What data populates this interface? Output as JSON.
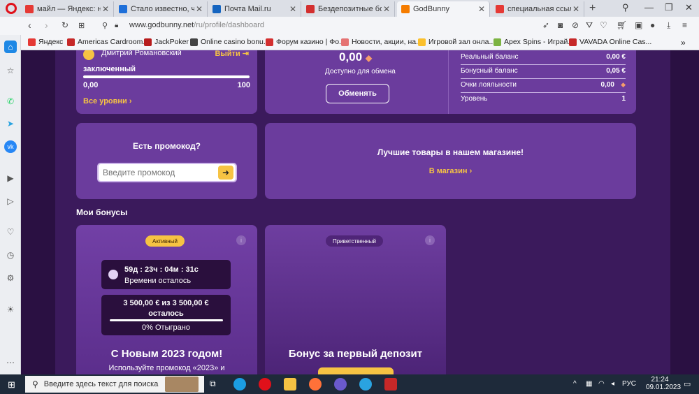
{
  "tabs": [
    {
      "title": "майл — Яндекс: нашло",
      "color": "#e53935",
      "active": false
    },
    {
      "title": "Стало известно, что пр",
      "color": "#1e6fd9",
      "active": false
    },
    {
      "title": "Почта Mail.ru",
      "color": "#1565c0",
      "active": false
    },
    {
      "title": "Бездепозитные бонус",
      "color": "#d32f2f",
      "active": false
    },
    {
      "title": "GodBunny",
      "color": "#f57c00",
      "active": true
    },
    {
      "title": "специальная ссылка на",
      "color": "#e53935",
      "active": false
    }
  ],
  "address": {
    "url_host": "www.godbunny.net",
    "url_path": "/ru/profile/dashboard"
  },
  "bookmarks": [
    {
      "label": "Яндекс",
      "color": "#e53935"
    },
    {
      "label": "Americas Cardroom...",
      "color": "#c62828"
    },
    {
      "label": "JackPoker",
      "color": "#b71c1c"
    },
    {
      "label": "Online casino bonu...",
      "color": "#444444"
    },
    {
      "label": "Форум казино | Фо...",
      "color": "#d32f2f"
    },
    {
      "label": "Новости, акции, на...",
      "color": "#e57373"
    },
    {
      "label": "Игровой зал онла...",
      "color": "#fbc02d"
    },
    {
      "label": "Apex Spins - Играй...",
      "color": "#7cb342"
    },
    {
      "label": "VAVADA Online Cas...",
      "color": "#c62828"
    }
  ],
  "level_card": {
    "user_name": "Дмитрий Романовский",
    "logout": "Выйти",
    "level_name": "заключенный",
    "progress_min": "0,00",
    "progress_max": "100",
    "progress_fraction": 0.0,
    "all_levels": "Все уровни"
  },
  "exchange_card": {
    "amount": "0,00",
    "available_label": "Доступно для обмена",
    "exchange_button": "Обменять"
  },
  "balances": [
    {
      "label": "Реальный баланс",
      "value": "0,00 €"
    },
    {
      "label": "Бонусный баланс",
      "value": "0,05 €"
    },
    {
      "label": "Очки лояльности",
      "value": "0,00"
    },
    {
      "label": "Уровень",
      "value": "1"
    }
  ],
  "promo_card": {
    "title": "Есть промокод?",
    "placeholder": "Введите промокод"
  },
  "shop_card": {
    "title": "Лучшие товары в нашем магазине!",
    "link": "В магазин"
  },
  "my_bonuses_title": "Мои бонусы",
  "bonus_cards": [
    {
      "badge": "Активный",
      "timer": "59д : 23ч : 04м : 31с",
      "timer_label": "Времени осталось",
      "wager": "3 500,00 € из 3 500,00 €",
      "wager_sub": "осталось",
      "wagered": "0% Отыграно",
      "title": "С Новым 2023 годом!",
      "desc": "Используйте промокод «2023» и"
    },
    {
      "badge": "Приветственный",
      "title": "Бонус за первый депозит"
    }
  ],
  "taskbar": {
    "search_placeholder": "Введите здесь текст для поиска",
    "lang": "РУС",
    "time": "21:24",
    "date": "09.01.2023"
  }
}
